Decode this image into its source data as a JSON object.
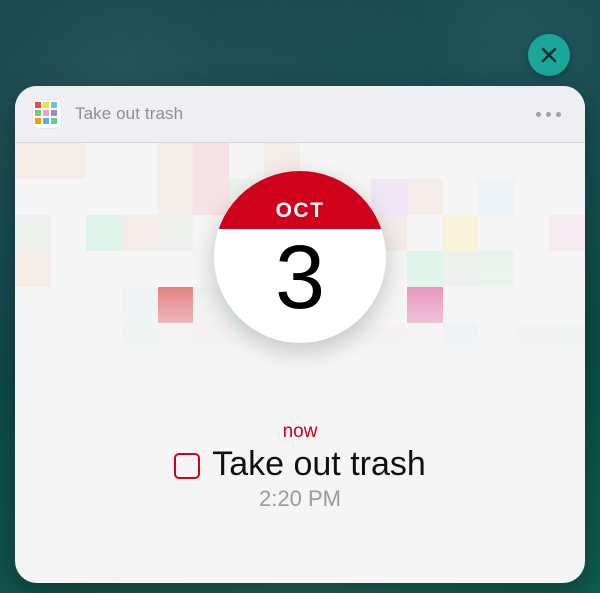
{
  "header": {
    "title": "Take out trash",
    "app_icon_name": "calendar-app-icon"
  },
  "date": {
    "month": "OCT",
    "day": "3"
  },
  "event": {
    "relative": "now",
    "title": "Take out trash",
    "time": "2:20 PM",
    "completed": false
  },
  "colors": {
    "accent_red": "#d0021b",
    "close_teal": "#1aa79a",
    "muted": "#8e8e93"
  }
}
